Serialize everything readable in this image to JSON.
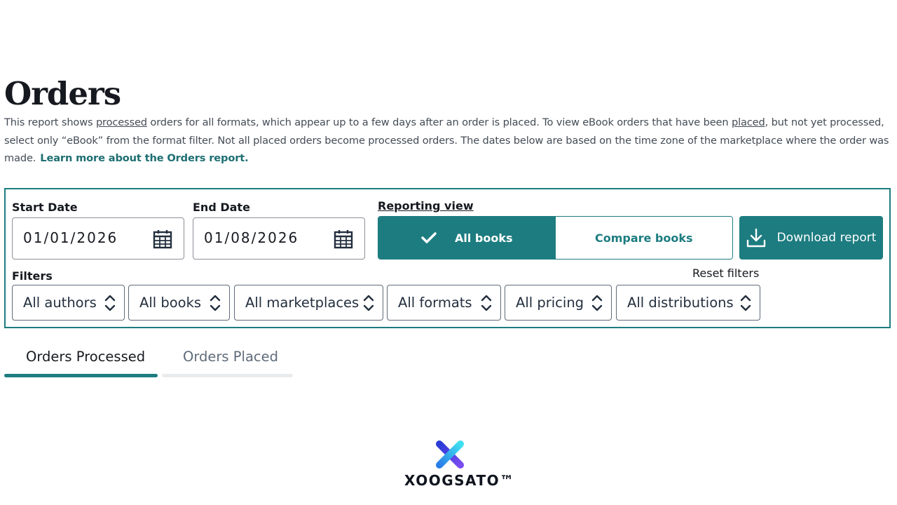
{
  "page": {
    "title": "Orders",
    "description_parts": {
      "p1": "This report shows ",
      "u1": "processed",
      "p2": " orders for all formats, which appear up to a few days after an order is placed. To view eBook orders that have been ",
      "u2": "placed",
      "p3": ", but not yet processed, select only “eBook” from the format filter. Not all placed orders become processed orders. The dates below are based on the time zone of the marketplace where the order was made.",
      "link": "Learn more about the Orders report."
    }
  },
  "dates": {
    "start_label": "Start Date",
    "start_value": "01/01/2026",
    "end_label": "End Date",
    "end_value": "01/08/2026"
  },
  "reporting_view": {
    "label": "Reporting view",
    "options": [
      "All books",
      "Compare books"
    ],
    "selected": "All books"
  },
  "download": {
    "label": "Download report"
  },
  "filters": {
    "label": "Filters",
    "reset_label": "Reset filters",
    "items": [
      "All authors",
      "All books",
      "All marketplaces",
      "All formats",
      "All pricing",
      "All distributions"
    ]
  },
  "tabs": [
    {
      "label": "Orders Processed",
      "active": true
    },
    {
      "label": "Orders Placed",
      "active": false
    }
  ],
  "branding": {
    "name": "XOOGSATO™"
  },
  "colors": {
    "accent": "#1d7c80",
    "text": "#16191f",
    "muted": "#5f6b7a"
  }
}
